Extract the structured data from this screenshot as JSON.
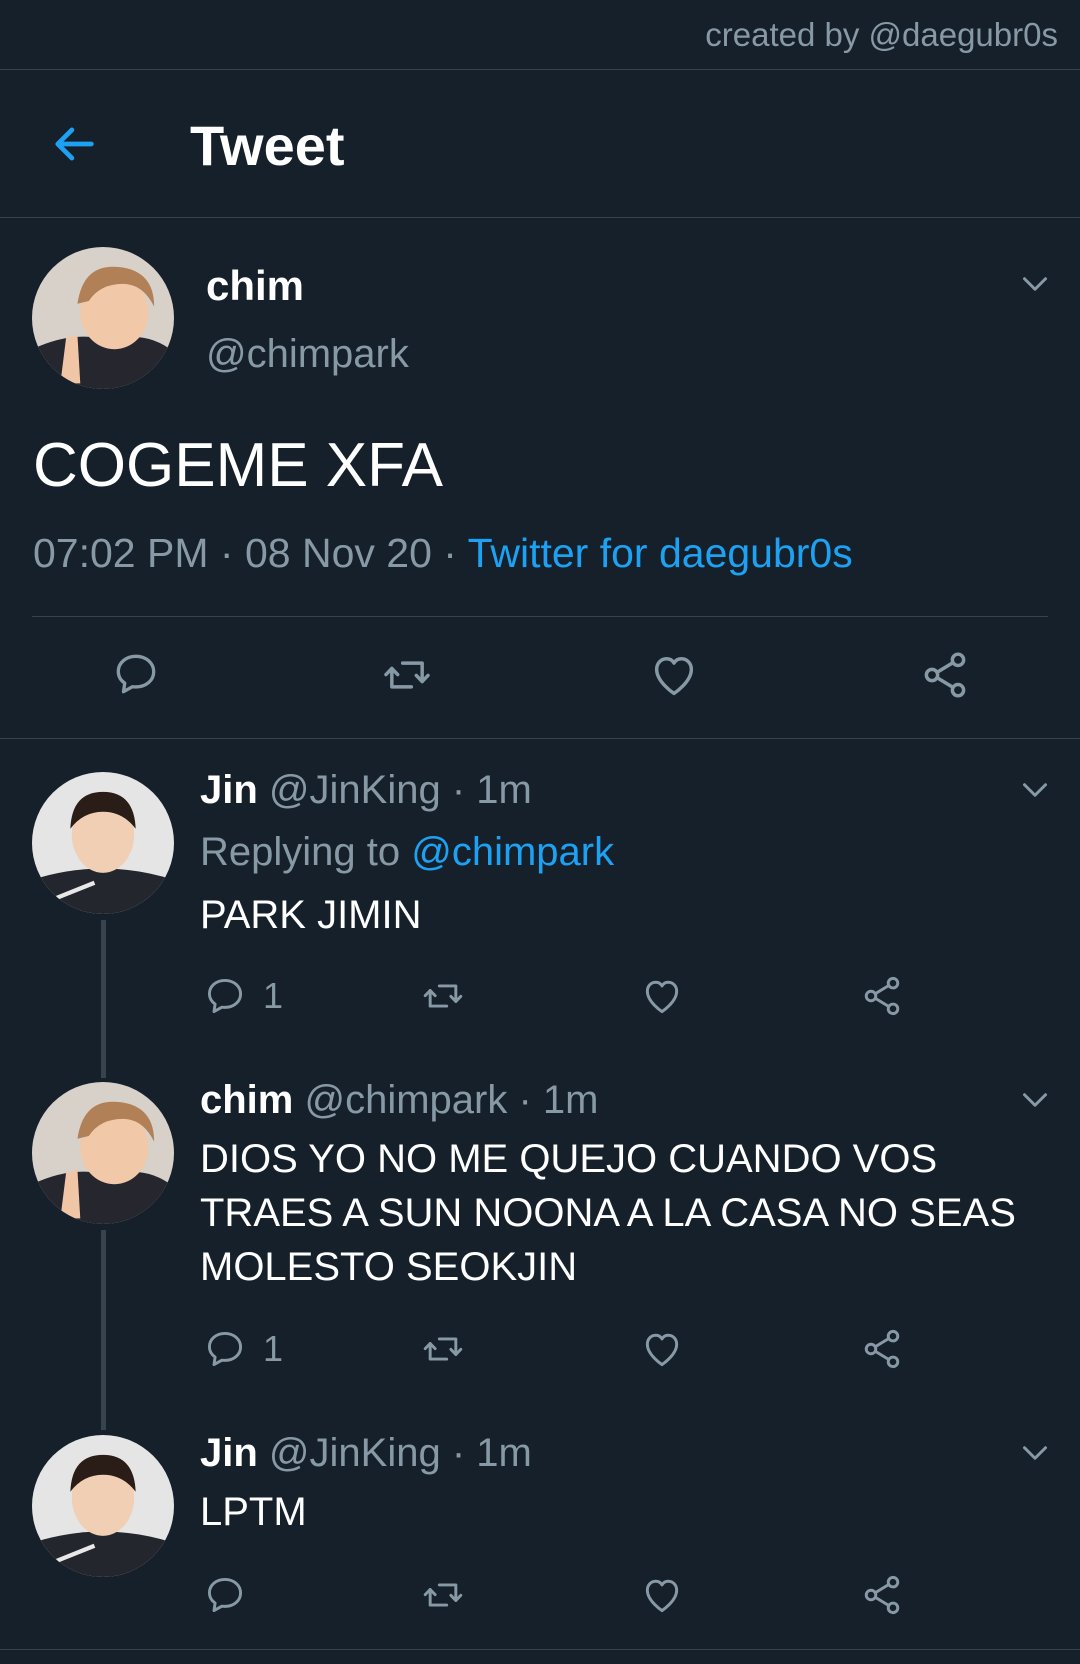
{
  "watermark": "created by @daegubr0s",
  "header": {
    "title": "Tweet",
    "back_icon": "arrow-left-icon"
  },
  "colors": {
    "background": "#15202b",
    "accent": "#1da1f2",
    "secondary_text": "#8899a6",
    "border": "#38444d"
  },
  "main_tweet": {
    "name": "chim",
    "handle": "@chimpark",
    "text": "COGEME XFA",
    "time": "07:02 PM",
    "separator": "·",
    "date": "08 Nov 20",
    "source": "Twitter for daegubr0s",
    "actions": [
      "reply-icon",
      "retweet-icon",
      "like-icon",
      "share-icon"
    ]
  },
  "replies": [
    {
      "name": "Jin",
      "handle": "@JinKing",
      "time": "· 1m",
      "replying_prefix": "Replying to",
      "replying_to": "@chimpark",
      "text": "PARK JIMIN",
      "reply_count": "1"
    },
    {
      "name": "chim",
      "handle": "@chimpark",
      "time": "· 1m",
      "text": "DIOS YO NO ME QUEJO CUANDO VOS TRAES A SUN NOONA A LA CASA NO SEAS MOLESTO SEOKJIN",
      "reply_count": "1"
    },
    {
      "name": "Jin",
      "handle": "@JinKing",
      "time": "· 1m",
      "text": "LPTM",
      "reply_count": ""
    }
  ]
}
